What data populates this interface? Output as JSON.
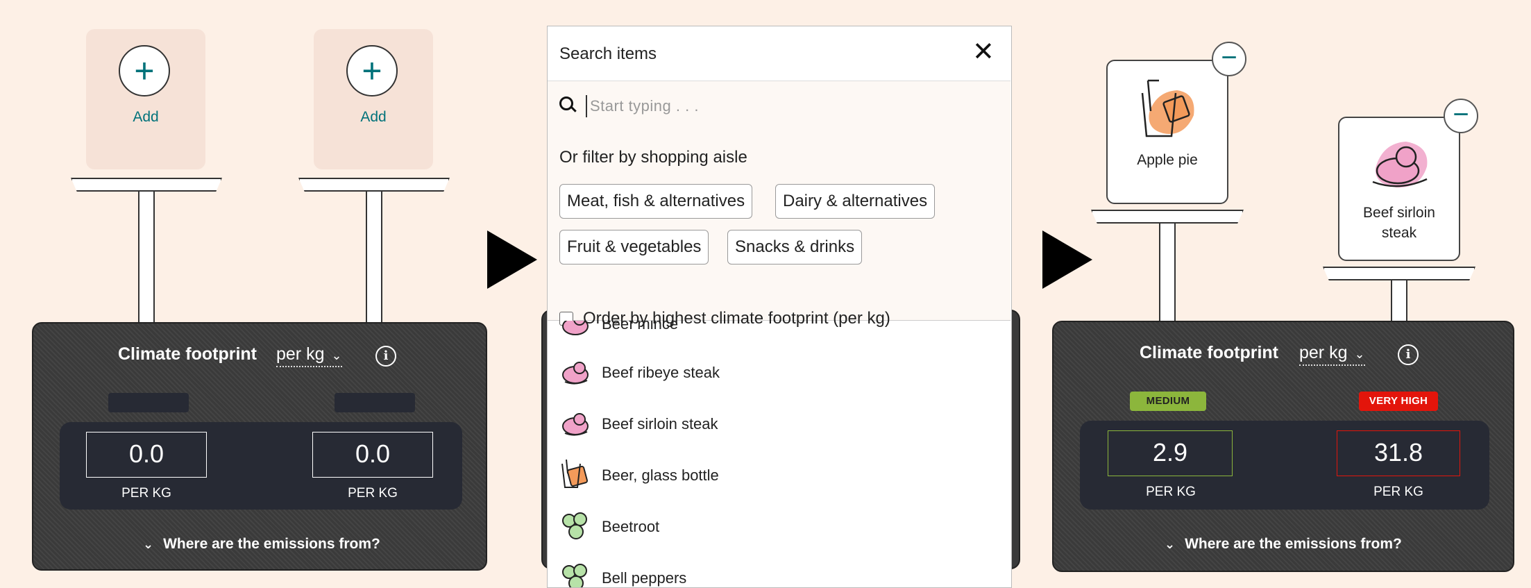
{
  "left_scale": {
    "add_label_1": "Add",
    "add_label_2": "Add",
    "title": "Climate footprint",
    "unit": "per kg",
    "value_1": "0.0",
    "value_2": "0.0",
    "unit_label_1": "PER KG",
    "unit_label_2": "PER KG",
    "emissions_toggle": "Where are the emissions from?"
  },
  "search_popup": {
    "title": "Search items",
    "close": "✕",
    "search_placeholder": "Start typing . . .",
    "filter_heading": "Or filter by shopping aisle",
    "aisles": [
      "Meat, fish & alternatives",
      "Dairy & alternatives",
      "Fruit & vegetables",
      "Snacks & drinks"
    ],
    "order_checkbox_label": "Order by highest climate footprint (per kg)",
    "order_checked": false,
    "results": [
      {
        "label": "Beef mince",
        "icon": "meat-icon"
      },
      {
        "label": "Beef ribeye steak",
        "icon": "meat-icon"
      },
      {
        "label": "Beef sirloin steak",
        "icon": "meat-icon"
      },
      {
        "label": "Beer, glass bottle",
        "icon": "drink-icon"
      },
      {
        "label": "Beetroot",
        "icon": "vegetable-icon"
      },
      {
        "label": "Bell peppers",
        "icon": "vegetable-icon"
      }
    ]
  },
  "right_scale": {
    "item_1": {
      "label": "Apple pie",
      "icon": "drink-icon"
    },
    "item_2": {
      "label_line1": "Beef sirloin",
      "label_line2": "steak",
      "icon": "meat-icon"
    },
    "title": "Climate footprint",
    "unit": "per kg",
    "badge_1": {
      "text": "MEDIUM",
      "color": "#8cb63c"
    },
    "badge_2": {
      "text": "VERY HIGH",
      "color": "#e3150b"
    },
    "value_1": "2.9",
    "value_2": "31.8",
    "unit_label_1": "PER KG",
    "unit_label_2": "PER KG",
    "emissions_toggle": "Where are the emissions from?"
  },
  "colors": {
    "background": "#fdf0e6",
    "teal_accent": "#00727a",
    "panel": "#3a3a3a",
    "value_area": "#272a34",
    "medium_border": "#8cb63c",
    "very_high_border": "#e3150b"
  }
}
